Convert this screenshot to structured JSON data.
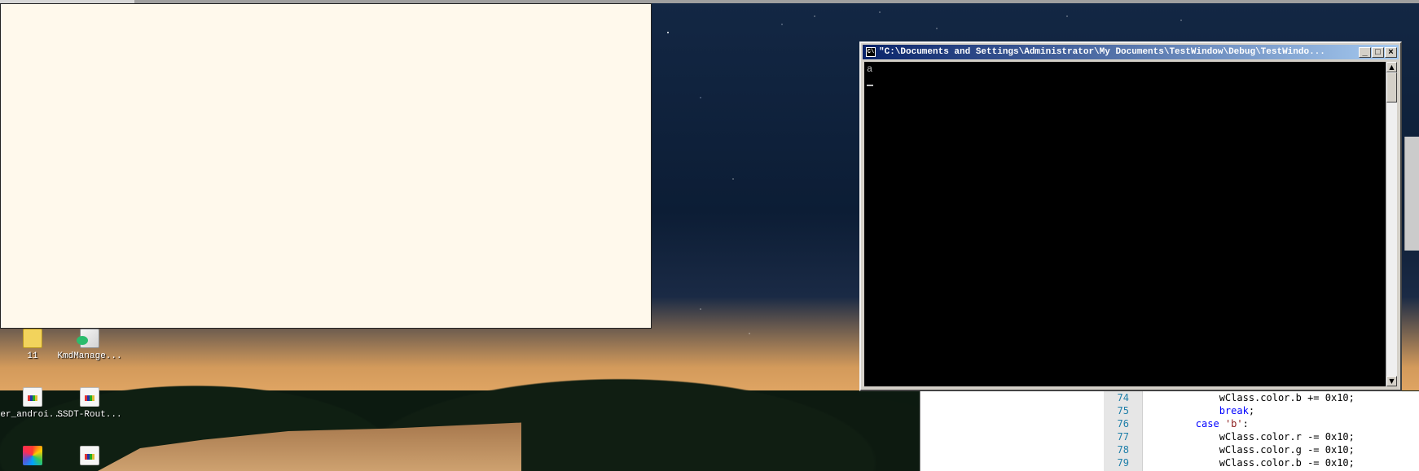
{
  "desktop": {
    "icons": [
      {
        "label": "11",
        "type": "folder-icon"
      },
      {
        "label": "KmdManage...",
        "type": "app-icon"
      },
      {
        "label": "er_androi...",
        "type": "document-icon"
      },
      {
        "label": "SSDT-Rout...",
        "type": "document-icon"
      },
      {
        "label": "",
        "type": "photos-icon"
      },
      {
        "label": "",
        "type": "document-icon"
      }
    ]
  },
  "console_window": {
    "title": "\"C:\\Documents and Settings\\Administrator\\My Documents\\TestWindow\\Debug\\TestWindo...",
    "icon_text": "C\\",
    "buttons": {
      "minimize": "_",
      "maximize": "□",
      "close": "×"
    },
    "output": "a"
  },
  "code_editor": {
    "lines": [
      {
        "num": "74",
        "segments": [
          {
            "text": "            wClass.color.b += 0x10;",
            "class": ""
          }
        ]
      },
      {
        "num": "75",
        "segments": [
          {
            "text": "            ",
            "class": ""
          },
          {
            "text": "break",
            "class": "kw"
          },
          {
            "text": ";",
            "class": ""
          }
        ]
      },
      {
        "num": "76",
        "segments": [
          {
            "text": "        ",
            "class": ""
          },
          {
            "text": "case",
            "class": "kw"
          },
          {
            "text": " ",
            "class": ""
          },
          {
            "text": "'b'",
            "class": "str"
          },
          {
            "text": ":",
            "class": ""
          }
        ]
      },
      {
        "num": "77",
        "segments": [
          {
            "text": "            wClass.color.r -= 0x10;",
            "class": ""
          }
        ]
      },
      {
        "num": "78",
        "segments": [
          {
            "text": "            wClass.color.g -= 0x10;",
            "class": ""
          }
        ]
      },
      {
        "num": "79",
        "segments": [
          {
            "text": "            wClass.color.b -= 0x10;",
            "class": ""
          }
        ]
      }
    ]
  }
}
